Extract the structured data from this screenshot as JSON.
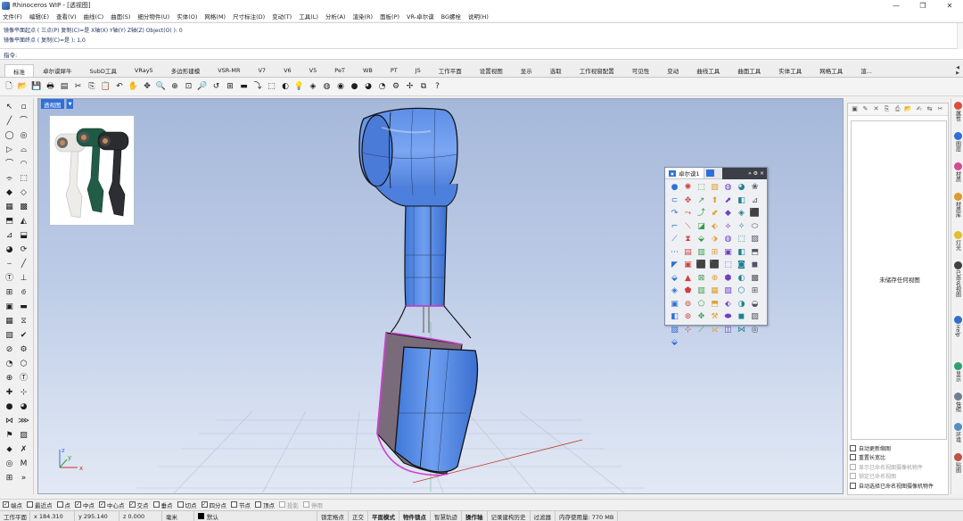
{
  "window": {
    "title": "Rhinoceros WIP - [透视图]",
    "controls": [
      "—",
      "❐",
      "✕"
    ]
  },
  "menu": [
    "文件(F)",
    "编辑(E)",
    "查看(V)",
    "曲线(C)",
    "曲面(S)",
    "细分物件(U)",
    "实体(O)",
    "网格(M)",
    "尺寸标注(D)",
    "变动(T)",
    "工具(L)",
    "分析(A)",
    "渲染(R)",
    "面板(P)",
    "VR-卓尔谟",
    "BG螺栓",
    "说明(H)"
  ],
  "history": [
    "镜像平面起点 ( 三点(P)  复制(C)=是  X轴(X)  Y轴(Y)  Z轴(Z)  Object(O) ): 0",
    "镜像平面终点 ( 复制(C)=是 ): 1,0"
  ],
  "command": {
    "prompt": "指令:",
    "value": ""
  },
  "toolbar_tabs": [
    "标准",
    "卓尔谟犀牛",
    "SubD工具",
    "VRay5",
    "多边形建模",
    "VSR-MR",
    "V7",
    "V6",
    "V5",
    "PeT",
    "WB",
    "PT",
    "JS",
    "工作平面",
    "设置视图",
    "显示",
    "选取",
    "工作视窗配置",
    "可见性",
    "变动",
    "曲线工具",
    "曲面工具",
    "实体工具",
    "网格工具",
    "渲..."
  ],
  "active_tab": "标准",
  "toolbar_icons": [
    {
      "name": "new-file-icon",
      "glyph": "🗋"
    },
    {
      "name": "open-icon",
      "glyph": "📂"
    },
    {
      "name": "save-icon",
      "glyph": "💾"
    },
    {
      "name": "print-icon",
      "glyph": "🖶"
    },
    {
      "name": "properties-icon",
      "glyph": "▤"
    },
    {
      "name": "cut-icon",
      "glyph": "✂"
    },
    {
      "name": "copy-icon",
      "glyph": "⎘"
    },
    {
      "name": "paste-icon",
      "glyph": "📋"
    },
    {
      "name": "undo-icon",
      "glyph": "↶"
    },
    {
      "name": "pan-icon",
      "glyph": "✋"
    },
    {
      "name": "rotate-view-icon",
      "glyph": "✥"
    },
    {
      "name": "zoom-icon",
      "glyph": "🔍"
    },
    {
      "name": "zoom-window-icon",
      "glyph": "⊕"
    },
    {
      "name": "zoom-extents-icon",
      "glyph": "⊡"
    },
    {
      "name": "zoom-selected-icon",
      "glyph": "🔎"
    },
    {
      "name": "undo-view-icon",
      "glyph": "↺"
    },
    {
      "name": "four-views-icon",
      "glyph": "⊞"
    },
    {
      "name": "cplane-icon",
      "glyph": "▬"
    },
    {
      "name": "set-view-icon",
      "glyph": "⤵"
    },
    {
      "name": "select-icon",
      "glyph": "⬚"
    },
    {
      "name": "hide-icon",
      "glyph": "◐"
    },
    {
      "name": "light-icon",
      "glyph": "💡"
    },
    {
      "name": "layer-icon",
      "glyph": "◈"
    },
    {
      "name": "render-icon",
      "glyph": "◍"
    },
    {
      "name": "color-wheel-icon",
      "glyph": "◉"
    },
    {
      "name": "material-sphere-icon",
      "glyph": "●"
    },
    {
      "name": "render-sphere-icon",
      "glyph": "◕"
    },
    {
      "name": "env-sphere-icon",
      "glyph": "◔"
    },
    {
      "name": "options-icon",
      "glyph": "⚙"
    },
    {
      "name": "gumball-icon",
      "glyph": "✢"
    },
    {
      "name": "plugin-icon",
      "glyph": "⧉"
    },
    {
      "name": "help-icon",
      "glyph": "?"
    }
  ],
  "left_tools": [
    "↖",
    "▫",
    "╱",
    "⌒",
    "◯",
    "◎",
    "▷",
    "⌓",
    "⌒",
    "◠",
    "⌯",
    "⬚",
    "◆",
    "◇",
    "▦",
    "▩",
    "⬒",
    "◭",
    "⊿",
    "⬓",
    "◕",
    "⟳",
    "⌣",
    "╱",
    "Ⓣ",
    "⊥",
    "⊞",
    "⟃",
    "▣",
    "▬",
    "▦",
    "⧖",
    "▧",
    "✔",
    "⊘",
    "⚙",
    "◔",
    "⬡",
    "⊕",
    "Ⓣ",
    "✚",
    "⊹",
    "●",
    "◕",
    "⋈",
    "⋙",
    "⚑",
    "▨",
    "⬥",
    "✗",
    "◎",
    "M",
    "⊞",
    "»"
  ],
  "viewport": {
    "label": "透视图",
    "axis": {
      "x": "x",
      "y": "y",
      "z": "z"
    }
  },
  "float_panel": {
    "tab_label": "卓尔谟1",
    "controls": "» ⚙ ×",
    "icons": [
      "●",
      "✺",
      "⬚",
      "▧",
      "◍",
      "◕",
      "❀",
      "⊂",
      "✥",
      "↗",
      "⬆",
      "⬈",
      "◧",
      "⊿",
      "↷",
      "⤳",
      "⤴",
      "⬋",
      "◆",
      "◈",
      "⬛",
      "⌐",
      "⟍",
      "◪",
      "⬖",
      "⟡",
      "✧",
      "⬭",
      "⟋",
      "⧗",
      "⬙",
      "⬗",
      "◍",
      "⬚",
      "▨",
      "⋯",
      "▤",
      "▥",
      "⊞",
      "▣",
      "◧",
      "⬒",
      "◤",
      "▣",
      "⬛",
      "⬛",
      "⬚",
      "◙",
      "◼",
      "⬙",
      "▲",
      "⊠",
      "⊕",
      "⬢",
      "◐",
      "▩",
      "◈",
      "⬟",
      "▥",
      "▦",
      "▧",
      "⬡",
      "⊞",
      "▣",
      "⊚",
      "⬠",
      "⬒",
      "⬖",
      "◑",
      "◒",
      "◧",
      "⊛",
      "✥",
      "⚒",
      "⬬",
      "◼",
      "▨",
      "▧",
      "⊹",
      "⟋",
      "⟗",
      "◫",
      "⋈",
      "◎",
      "⬙"
    ]
  },
  "right_panel": {
    "toolbar_icons": [
      "▣",
      "✎",
      "✕",
      "⎘",
      "⎙",
      "📂",
      "✍",
      "⇆",
      "✂"
    ],
    "empty_text": "未储存任何视图",
    "options": [
      {
        "label": "自动更新缩图",
        "enabled": true
      },
      {
        "label": "重置长宽比",
        "enabled": true
      },
      {
        "label": "显示已命名视图摄像机物件",
        "enabled": false
      },
      {
        "label": "锁定已命名视图",
        "enabled": false
      },
      {
        "label": "自动选择已命名视图摄像机物件",
        "enabled": true
      }
    ]
  },
  "right_strip": [
    {
      "label": "属性",
      "color": "#e04a3a"
    },
    {
      "label": "图层",
      "color": "#2f6fd8"
    },
    {
      "label": "材质",
      "color": "#d64a90"
    },
    {
      "label": "材质库",
      "color": "#e09a2a"
    },
    {
      "label": "灯光",
      "color": "#e0c030"
    },
    {
      "label": "已命名视图",
      "color": "#404040"
    },
    {
      "label": "Help",
      "color": "#3070c8"
    },
    {
      "label": "显示",
      "color": "#30a070"
    },
    {
      "label": "快照",
      "color": "#708090"
    },
    {
      "label": "环境",
      "color": "#5090c0"
    },
    {
      "label": "贴图",
      "color": "#c05040"
    }
  ],
  "osnaps": [
    {
      "label": "端点",
      "checked": true,
      "enabled": true
    },
    {
      "label": "最近点",
      "checked": false,
      "enabled": true
    },
    {
      "label": "点",
      "checked": false,
      "enabled": true
    },
    {
      "label": "中点",
      "checked": true,
      "enabled": true
    },
    {
      "label": "中心点",
      "checked": true,
      "enabled": true
    },
    {
      "label": "交点",
      "checked": true,
      "enabled": true
    },
    {
      "label": "垂点",
      "checked": false,
      "enabled": true
    },
    {
      "label": "切点",
      "checked": false,
      "enabled": true
    },
    {
      "label": "四分点",
      "checked": true,
      "enabled": true
    },
    {
      "label": "节点",
      "checked": false,
      "enabled": true
    },
    {
      "label": "顶点",
      "checked": false,
      "enabled": true
    },
    {
      "label": "投影",
      "checked": false,
      "enabled": false
    },
    {
      "label": "停用",
      "checked": false,
      "enabled": false
    }
  ],
  "status": {
    "cplane": "工作平面",
    "x": "x 184.310",
    "y": "y 295.140",
    "z": "z 0.000",
    "unit": "毫米",
    "layer": "默认",
    "modes": [
      {
        "label": "锁定格点",
        "bold": false
      },
      {
        "label": "正交",
        "bold": false
      },
      {
        "label": "平面模式",
        "bold": true
      },
      {
        "label": "物件锁点",
        "bold": true
      },
      {
        "label": "智慧轨迹",
        "bold": false
      },
      {
        "label": "操作轴",
        "bold": true
      },
      {
        "label": "记录建构历史",
        "bold": false
      },
      {
        "label": "过滤器",
        "bold": false
      },
      {
        "label": "内存使用量: 770 MB",
        "bold": false
      }
    ]
  }
}
